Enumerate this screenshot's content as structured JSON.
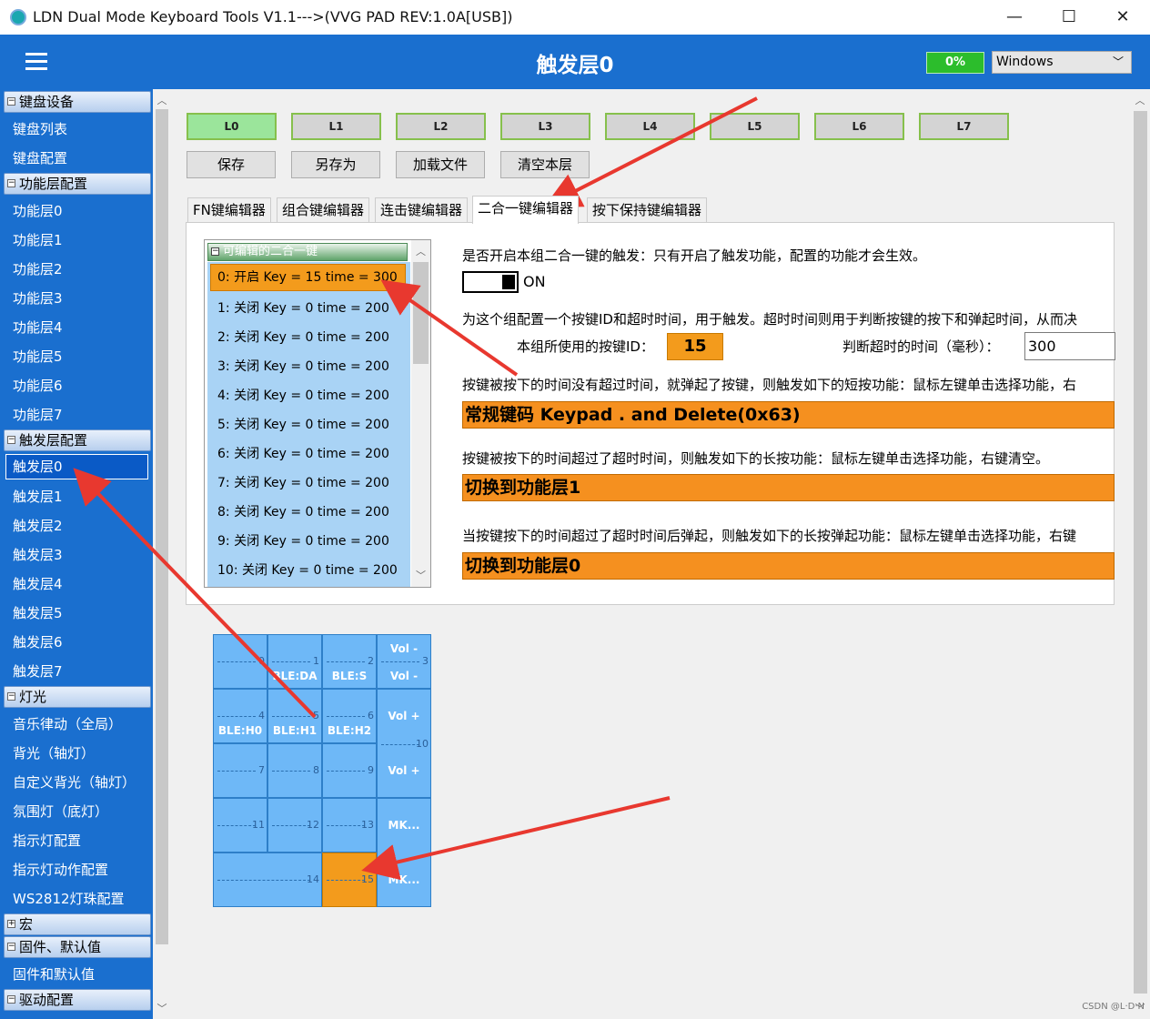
{
  "window": {
    "title": "LDN Dual Mode Keyboard Tools V1.1--->(VVG PAD REV:1.0A[USB])",
    "minimize": "—",
    "maximize": "☐",
    "close": "✕"
  },
  "header": {
    "title": "触发层0",
    "progress": "0%",
    "os_select": "Windows"
  },
  "sidebar": {
    "groups": [
      {
        "label": "键盘设备",
        "toggle": "⊟"
      },
      {
        "label": "功能层配置",
        "toggle": "⊟"
      },
      {
        "label": "触发层配置",
        "toggle": "⊟"
      },
      {
        "label": "灯光",
        "toggle": "⊟"
      },
      {
        "label": "宏",
        "toggle": "⊞"
      },
      {
        "label": "固件、默认值",
        "toggle": "⊟"
      },
      {
        "label": "驱动配置",
        "toggle": "⊟"
      }
    ],
    "items": [
      "键盘列表",
      "键盘配置",
      "功能层0",
      "功能层1",
      "功能层2",
      "功能层3",
      "功能层4",
      "功能层5",
      "功能层6",
      "功能层7",
      "触发层0",
      "触发层1",
      "触发层2",
      "触发层3",
      "触发层4",
      "触发层5",
      "触发层6",
      "触发层7",
      "音乐律动（全局）",
      "背光（轴灯）",
      "自定义背光（轴灯）",
      "氛围灯（底灯）",
      "指示灯配置",
      "指示灯动作配置",
      "WS2812灯珠配置",
      "固件和默认值"
    ]
  },
  "layers": [
    "L0",
    "L1",
    "L2",
    "L3",
    "L4",
    "L5",
    "L6",
    "L7"
  ],
  "actions": [
    "保存",
    "另存为",
    "加载文件",
    "清空本层"
  ],
  "tabs": [
    "FN键编辑器",
    "组合键编辑器",
    "连击键编辑器",
    "二合一键编辑器",
    "按下保持键编辑器"
  ],
  "list": {
    "header": "可编辑的二合一键",
    "toggle": "⊟",
    "items": [
      "0: 开启 Key = 15 time = 300",
      "1: 关闭 Key = 0 time = 200",
      "2: 关闭 Key = 0 time = 200",
      "3: 关闭 Key = 0 time = 200",
      "4: 关闭 Key = 0 time = 200",
      "5: 关闭 Key = 0 time = 200",
      "6: 关闭 Key = 0 time = 200",
      "7: 关闭 Key = 0 time = 200",
      "8: 关闭 Key = 0 time = 200",
      "9: 关闭 Key = 0 time = 200",
      "10: 关闭 Key = 0 time = 200"
    ]
  },
  "panel": {
    "enable_text": "是否开启本组二合一键的触发：只有开启了触发功能，配置的功能才会生效。",
    "toggle_state": "ON",
    "config_text": "为这个组配置一个按键ID和超时时间，用于触发。超时时间则用于判断按键的按下和弹起时间，从而决",
    "keyid_label": "本组所使用的按键ID：",
    "keyid_value": "15",
    "timeout_label": "判断超时的时间（毫秒）：",
    "timeout_value": "300",
    "short_text": "按键被按下的时间没有超过时间，就弹起了按键，则触发如下的短按功能：鼠标左键单击选择功能，右",
    "short_func": "常规键码 Keypad . and Delete(0x63)",
    "long_text": "按键被按下的时间超过了超时时间，则触发如下的长按功能：鼠标左键单击选择功能，右键清空。",
    "long_func": "切换到功能层1",
    "release_text": "当按键按下的时间超过了超时时间后弹起，则触发如下的长按弹起功能：鼠标左键单击选择功能，右键",
    "release_func": "切换到功能层0"
  },
  "keys": [
    {
      "num": "0",
      "label": ""
    },
    {
      "num": "1",
      "label": "BLE:DA"
    },
    {
      "num": "2",
      "label": "BLE:S"
    },
    {
      "num": "3",
      "label": "Vol -",
      "label2": "Vol -"
    },
    {
      "num": "4",
      "label": "BLE:H0"
    },
    {
      "num": "5",
      "label": "BLE:H1"
    },
    {
      "num": "6",
      "label": "BLE:H2"
    },
    {
      "num": "10",
      "label": "Vol +",
      "label2": "Vol +"
    },
    {
      "num": "7",
      "label": ""
    },
    {
      "num": "8",
      "label": ""
    },
    {
      "num": "9",
      "label": ""
    },
    {
      "num": "11",
      "label": ""
    },
    {
      "num": "12",
      "label": ""
    },
    {
      "num": "13",
      "label": ""
    },
    {
      "num": "",
      "label": "MK...",
      "label2": "MK..."
    },
    {
      "num": "14",
      "label": ""
    },
    {
      "num": "15",
      "label": ""
    }
  ],
  "colors": {
    "accent": "#1a6fcf",
    "highlight": "#f39b1c",
    "key": "#6eb8f7",
    "arrow": "#e8382f"
  },
  "watermark": "CSDN @L·D·N"
}
